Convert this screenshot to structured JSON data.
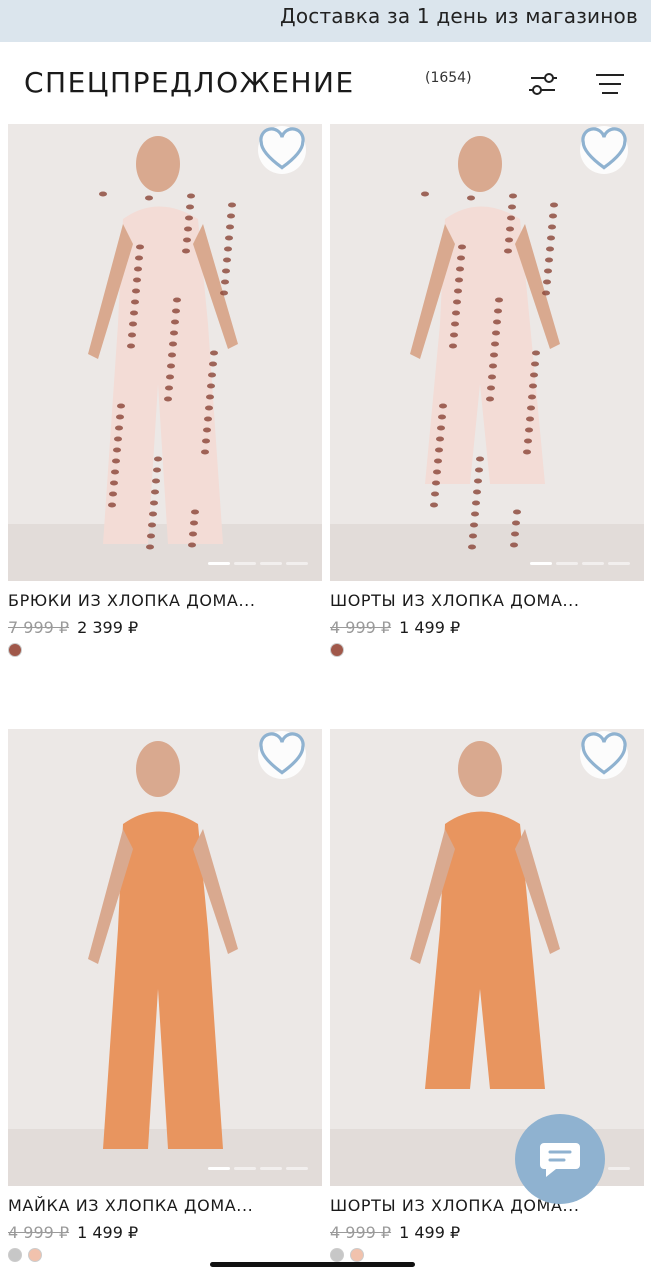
{
  "promo": {
    "text": "Доставка за 1 день из магазинов"
  },
  "header": {
    "title": "СПЕЦПРЕДЛОЖЕНИЕ",
    "count": "(1654)",
    "filter_icon": "filter-sliders-icon",
    "menu_icon": "hamburger-menu-icon"
  },
  "products": [
    {
      "name": "БРЮКИ ИЗ ХЛОПКА ДОМА...",
      "old_price": "7 999 ₽",
      "new_price": "2 399 ₽",
      "swatch_colors": [
        "#a0584a"
      ],
      "garment_color": "#f3dcd6",
      "active_slide": 1
    },
    {
      "name": "ШОРТЫ ИЗ ХЛОПКА ДОМА...",
      "old_price": "4 999 ₽",
      "new_price": "1 499 ₽",
      "swatch_colors": [
        "#a0584a"
      ],
      "garment_color": "#f3dcd6",
      "active_slide": 1
    },
    {
      "name": "МАЙКА ИЗ ХЛОПКА ДОМА...",
      "old_price": "4 999 ₽",
      "new_price": "1 499 ₽",
      "swatch_colors": [
        "#c7c7c7",
        "#f1c2ad"
      ],
      "garment_color": "#e8955f",
      "active_slide": 1
    },
    {
      "name": "ШОРТЫ ИЗ ХЛОПКА ДОМА...",
      "old_price": "4 999 ₽",
      "new_price": "1 499 ₽",
      "swatch_colors": [
        "#c7c7c7",
        "#f1c2ad"
      ],
      "garment_color": "#e8955f",
      "active_slide": 1
    }
  ],
  "chat": {
    "icon": "chat-bubble-icon",
    "color": "#8fb2d0"
  },
  "colors": {
    "promo_bg": "#dbe5ed",
    "photo_bg": "#ece8e6"
  }
}
